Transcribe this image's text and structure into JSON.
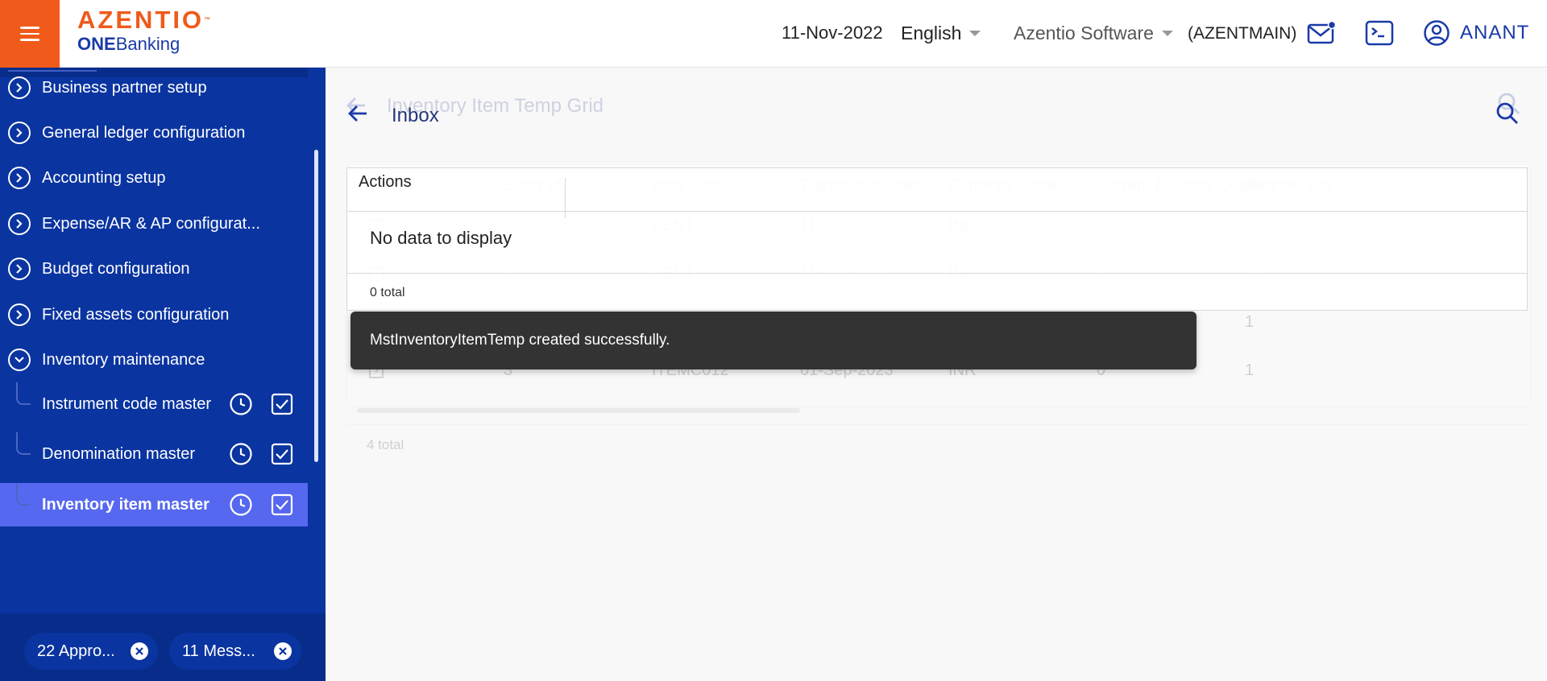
{
  "header": {
    "logo_main": "AZENTIO",
    "logo_tm": "™",
    "logo_sub_bold": "ONE",
    "logo_sub_rest": "Banking",
    "date": "11-Nov-2022",
    "language": "English",
    "company": "Azentio Software",
    "company_code": "(AZENTMAIN)",
    "user": "ANANT",
    "icons": [
      "menu-icon",
      "mail-icon",
      "terminal-icon",
      "user-circle-icon"
    ]
  },
  "sidebar": {
    "menu": [
      {
        "label": "Business partner setup",
        "icon": "chevron-right-circle-icon"
      },
      {
        "label": "General ledger configuration",
        "icon": "chevron-right-circle-icon"
      },
      {
        "label": "Accounting setup",
        "icon": "chevron-right-circle-icon"
      },
      {
        "label": "Expense/AR & AP configurat...",
        "icon": "chevron-right-circle-icon"
      },
      {
        "label": "Budget configuration",
        "icon": "chevron-right-circle-icon"
      },
      {
        "label": "Fixed assets configuration",
        "icon": "chevron-right-circle-icon"
      },
      {
        "label": "Inventory maintenance",
        "icon": "chevron-down-circle-icon"
      }
    ],
    "sub_items": [
      {
        "label": "Instrument code master"
      },
      {
        "label": "Denomination master"
      },
      {
        "label": "Inventory item master",
        "active": true
      }
    ],
    "chips": [
      {
        "label": "22 Appro..."
      },
      {
        "label": "11 Mess..."
      }
    ]
  },
  "background_grid": {
    "title": "Inventory Item Temp Grid",
    "columns": [
      "Actions",
      "Entity Id",
      "Item Code",
      "Transaction Date",
      "Currency Code",
      "Current Balance Quanti",
      "Reorder Lev"
    ],
    "rows": [
      [
        "3",
        "PEN1",
        "11-Nov-2022",
        "INR",
        "0",
        "10"
      ],
      [
        "3",
        "PEN1",
        "11-Nov-2022",
        "INR",
        "0",
        "10"
      ],
      [
        "",
        "",
        "",
        "",
        "0",
        "1"
      ],
      [
        "3",
        "ITEMC012",
        "01-Sep-2023",
        "INR",
        "0",
        "1"
      ]
    ],
    "total": "4 total"
  },
  "inbox": {
    "title": "Inbox",
    "column": "Actions",
    "empty_text": "No data to display",
    "total": "0 total"
  },
  "toast": {
    "message": "MstInventoryItemTemp created successfully."
  },
  "colors": {
    "brand_orange": "#f05a1a",
    "sidebar_blue": "#0a34a0",
    "active_item": "#5668f0",
    "toast_bg": "#333333"
  }
}
